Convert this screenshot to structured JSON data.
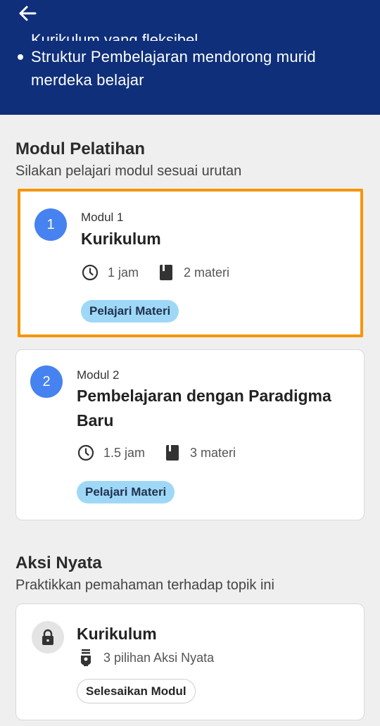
{
  "header": {
    "cut_line": "Kurikulum yang fleksibel",
    "bullet": "Struktur Pembelajaran mendorong murid merdeka belajar"
  },
  "modul_section": {
    "title": "Modul Pelatihan",
    "subtitle": "Silakan pelajari modul sesuai urutan",
    "modules": [
      {
        "number": "1",
        "label": "Modul 1",
        "title": "Kurikulum",
        "duration": "1 jam",
        "materials": "2 materi",
        "button": "Pelajari Materi",
        "highlighted": true
      },
      {
        "number": "2",
        "label": "Modul 2",
        "title": "Pembelajaran dengan Paradigma Baru",
        "duration": "1.5 jam",
        "materials": "3 materi",
        "button": "Pelajari Materi",
        "highlighted": false
      }
    ]
  },
  "aksi_section": {
    "title": "Aksi Nyata",
    "subtitle": "Praktikkan pemahaman terhadap topik ini",
    "card": {
      "title": "Kurikulum",
      "options": "3 pilihan Aksi Nyata",
      "button": "Selesaikan Modul",
      "locked": true
    }
  },
  "icons": {
    "back": "arrow-left-icon",
    "clock": "clock-icon",
    "book": "book-icon",
    "lock": "lock-icon",
    "lamp": "lightbulb-icon"
  },
  "colors": {
    "header_bg": "#0f2f7a",
    "accent_blue": "#4682f0",
    "highlight_border": "#f5960a",
    "pill_bg": "#9fd8f7"
  }
}
